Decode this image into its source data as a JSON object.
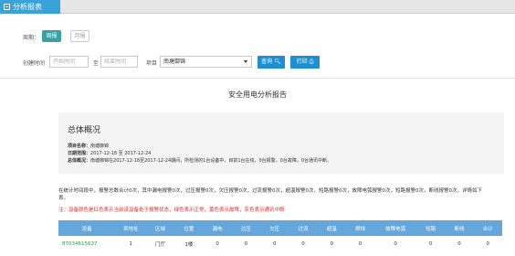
{
  "header": {
    "title": "分析报表",
    "icon": "report-icon"
  },
  "period": {
    "label": "周期：",
    "tabs": [
      {
        "label": "周报",
        "active": true
      },
      {
        "label": "月报",
        "active": false
      }
    ]
  },
  "filters": {
    "created_label": "创建时间",
    "start_placeholder": "开始时间",
    "to_label": "至",
    "end_placeholder": "结束时间",
    "project_label": "项目",
    "project_value": "南塘御锦",
    "query_label": "查询",
    "print_label": "打印",
    "query_icon": "search-icon",
    "print_icon": "print-icon"
  },
  "report": {
    "title": "安全用电分析报告",
    "overview_heading": "总体概况",
    "project_name_label": "项目名称：",
    "project_name_value": "南塘御锦",
    "date_range_label": "日期范围：",
    "date_range_value": "2017-12-18 至 2017-12-24",
    "general_label": "总体概况：",
    "general_value": "南塘御锦在2017-12-18至2017-12-24期间，所检测的1台设备中，目前1台在线，0台报警，0台故障，0台通讯中断。",
    "summary": "在统计时间段中，报警总数合计0次，其中漏电报警0次，过压报警0次，欠压报警0次，过流报警0次，超温报警0次，短路报警0次，故障电弧报警0次，短路报警0次，断线报警0次，详情如下表。",
    "warning": "注：设备颜色是红色表示当前该设备处于报警状态，绿色表示正常，黄色表示故障，灰色表示通讯中断"
  },
  "table": {
    "headers": [
      "设备",
      "表地址",
      "区域",
      "位置",
      "漏电",
      "过压",
      "欠压",
      "过流",
      "超温",
      "燃线",
      "故障电弧",
      "短路",
      "断线",
      "合计"
    ],
    "rows": [
      [
        "87034615637",
        "1",
        "门厅",
        "1楼",
        "0",
        "0",
        "0",
        "0",
        "0",
        "0",
        "0",
        "0",
        "0",
        "0"
      ]
    ]
  },
  "colors": {
    "accent": "#38a2da",
    "tab_active": "#3aa0a5",
    "button": "#1f8fd4",
    "table_header": "#63a7dd",
    "warning": "#d9302c",
    "device_ok": "#2f9b3a"
  }
}
